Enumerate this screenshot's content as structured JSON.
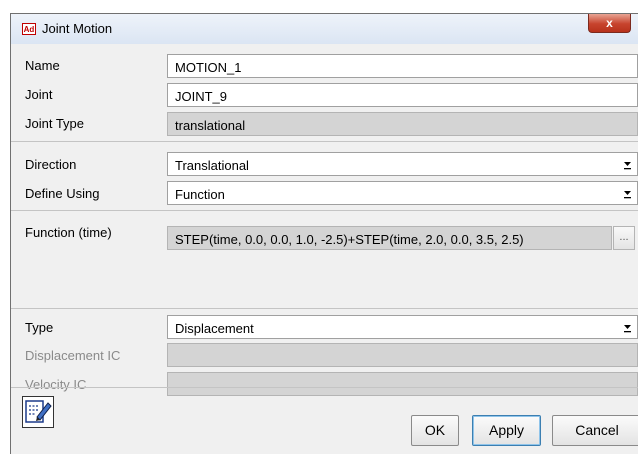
{
  "window": {
    "title": "Joint Motion",
    "app_badge": "Ad",
    "close_glyph": "x"
  },
  "fields": {
    "name": {
      "label": "Name",
      "value": "MOTION_1"
    },
    "joint": {
      "label": "Joint",
      "value": "JOINT_9"
    },
    "joint_type": {
      "label": "Joint Type",
      "value": "translational"
    },
    "direction": {
      "label": "Direction",
      "value": "Translational"
    },
    "define_using": {
      "label": "Define Using",
      "value": "Function"
    },
    "function": {
      "label": "Function (time)",
      "value": "STEP(time, 0.0, 0.0, 1.0, -2.5)+STEP(time, 2.0, 0.0, 3.5, 2.5)",
      "browse_label": "..."
    },
    "type": {
      "label": "Type",
      "value": "Displacement"
    },
    "displacement_ic": {
      "label": "Displacement IC",
      "value": ""
    },
    "velocity_ic": {
      "label": "Velocity IC",
      "value": ""
    }
  },
  "buttons": {
    "ok": "OK",
    "apply": "Apply",
    "cancel": "Cancel"
  },
  "icons": {
    "app": "adams-app-icon",
    "close": "close-icon",
    "dropdown": "dropdown-arrow-icon",
    "edit": "edit-pencil-icon"
  }
}
